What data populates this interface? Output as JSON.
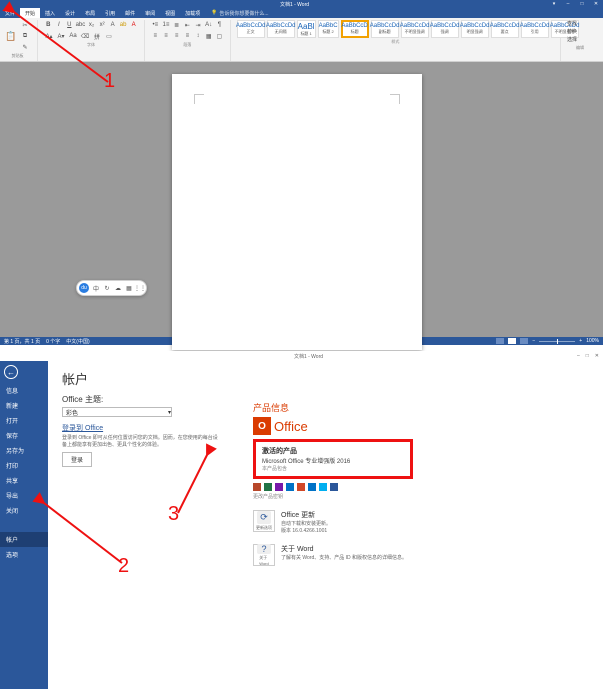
{
  "top": {
    "title": "文档1 - Word",
    "tabs": [
      "文件",
      "开始",
      "插入",
      "设计",
      "布局",
      "引用",
      "邮件",
      "审阅",
      "视图",
      "加载项"
    ],
    "tell_me": "告诉我你想要做什么...",
    "ribbon": {
      "clipboard_label": "剪贴板",
      "font_label": "字体",
      "paragraph_label": "段落",
      "styles_label": "样式",
      "editing_label": "编辑"
    },
    "styles": [
      {
        "sample": "AaBbCcDd",
        "label": "正文"
      },
      {
        "sample": "AaBbCcDd",
        "label": "无间隔"
      },
      {
        "sample": "AaBl",
        "label": "标题 1"
      },
      {
        "sample": "AaBbC",
        "label": "标题 2"
      },
      {
        "sample": "AaBbCcD",
        "label": "标题"
      },
      {
        "sample": "AaBbCcDd",
        "label": "副标题"
      },
      {
        "sample": "AaBbCcDd",
        "label": "不明显强调"
      },
      {
        "sample": "AaBbCcDd",
        "label": "强调"
      },
      {
        "sample": "AaBbCcDd",
        "label": "明显强调"
      },
      {
        "sample": "AaBbCcDd",
        "label": "要点"
      },
      {
        "sample": "AaBbCcDd",
        "label": "引用"
      },
      {
        "sample": "AaBbCcDd",
        "label": "不明显参考"
      }
    ],
    "editing": {
      "find": "查找",
      "replace": "替换",
      "select": "选择"
    },
    "status": {
      "page": "第 1 页，共 1 页",
      "words": "0 个字",
      "lang": "中文(中国)",
      "zoom": "100%"
    }
  },
  "bottom": {
    "title": "文档1 - Word",
    "sidebar": [
      "信息",
      "新建",
      "打开",
      "保存",
      "另存为",
      "打印",
      "共享",
      "导出",
      "关闭",
      "",
      "帐户",
      "选项"
    ],
    "account": {
      "heading": "帐户",
      "theme_label": "Office 主题:",
      "theme_value": "彩色",
      "sign_in_head": "登录到 Office",
      "sign_in_desc": "登录到 Office 即可从任何位置访问您的文档。因而，在您使用的每台设备上都能享有更加出色、更具个性化的体验。",
      "sign_in_btn": "登录"
    },
    "product": {
      "head": "产品信息",
      "brand": "Office",
      "activated": "激活的产品",
      "edition": "Microsoft Office 专业增强版 2016",
      "belongs": "本产品包含",
      "change_key": "更改产品密钥",
      "update_head": "Office 更新",
      "update_sub": "自动下载和安装更新。",
      "update_ver": "版本 16.0.4266.1001",
      "update_btn": "更新选项",
      "about_head": "关于 Word",
      "about_sub": "了解有关 Word、支持、产品 ID 和版权信息的详细信息。",
      "about_btn": "关于\nWord"
    }
  },
  "annotations": {
    "n1": "1",
    "n2": "2",
    "n3": "3"
  }
}
